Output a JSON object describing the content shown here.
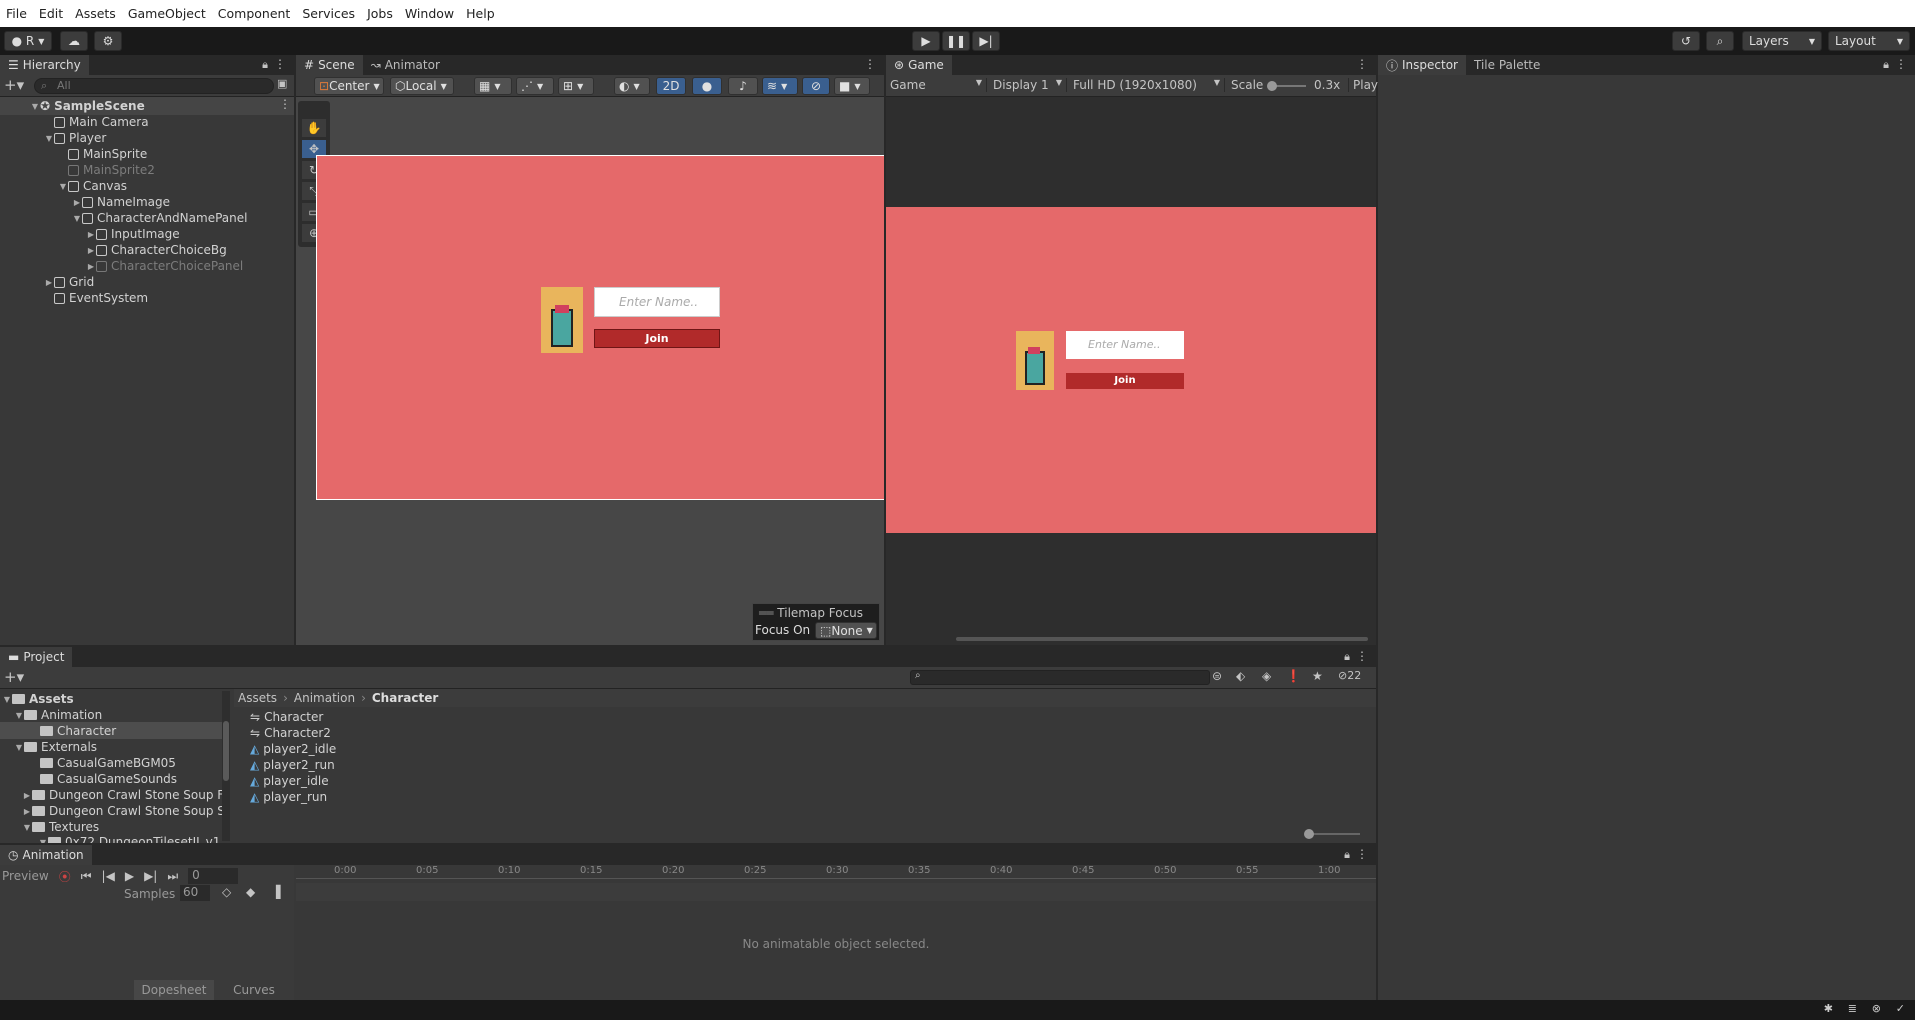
{
  "menu": [
    "File",
    "Edit",
    "Assets",
    "GameObject",
    "Component",
    "Services",
    "Jobs",
    "Window",
    "Help"
  ],
  "toolbar": {
    "account": "R",
    "layers": "Layers",
    "layout": "Layout"
  },
  "hierarchy": {
    "tab": "Hierarchy",
    "search_placeholder": "All",
    "items": [
      {
        "label": "SampleScene",
        "bold": true
      },
      {
        "label": "Main Camera"
      },
      {
        "label": "Player"
      },
      {
        "label": "MainSprite"
      },
      {
        "label": "MainSprite2"
      },
      {
        "label": "Canvas"
      },
      {
        "label": "NameImage"
      },
      {
        "label": "CharacterAndNamePanel"
      },
      {
        "label": "InputImage"
      },
      {
        "label": "CharacterChoiceBg"
      },
      {
        "label": "CharacterChoicePanel"
      },
      {
        "label": "Grid"
      },
      {
        "label": "EventSystem"
      }
    ]
  },
  "scene": {
    "tab_scene": "Scene",
    "tab_animator": "Animator",
    "pivot": "Center",
    "space": "Local",
    "mode_2d": "2D",
    "input_placeholder": "Enter Name..",
    "join": "Join",
    "tilemap_focus": "Tilemap Focus",
    "focus_on": "Focus On",
    "focus_value": "None"
  },
  "game": {
    "tab": "Game",
    "view": "Game",
    "display": "Display 1",
    "resolution": "Full HD (1920x1080)",
    "scale_label": "Scale",
    "scale_value": "0.3x",
    "play": "Play",
    "input_placeholder": "Enter Name..",
    "join": "Join"
  },
  "inspector": {
    "tab": "Inspector",
    "tab2": "Tile Palette"
  },
  "project": {
    "tab": "Project",
    "tree": [
      {
        "label": "Assets",
        "bold": true
      },
      {
        "label": "Animation"
      },
      {
        "label": "Character"
      },
      {
        "label": "Externals"
      },
      {
        "label": "CasualGameBGM05"
      },
      {
        "label": "CasualGameSounds"
      },
      {
        "label": "Dungeon Crawl Stone Soup F"
      },
      {
        "label": "Dungeon Crawl Stone Soup S"
      },
      {
        "label": "Textures"
      },
      {
        "label": "0x72 DungeonTilesetII_v1"
      }
    ],
    "breadcrumb": [
      "Assets",
      "Animation",
      "Character"
    ],
    "hidden_count": "22",
    "files": [
      "Character",
      "Character2",
      "player2_idle",
      "player2_run",
      "player_idle",
      "player_run"
    ]
  },
  "animation": {
    "tab": "Animation",
    "preview": "Preview",
    "frame": "0",
    "samples_label": "Samples",
    "samples": "60",
    "empty": "No animatable object selected.",
    "dopesheet": "Dopesheet",
    "curves": "Curves",
    "ticks": [
      "0:00",
      "0:05",
      "0:10",
      "0:15",
      "0:20",
      "0:25",
      "0:30",
      "0:35",
      "0:40",
      "0:45",
      "0:50",
      "0:55",
      "1:00"
    ]
  },
  "colors": {
    "canvas": "#e5696a",
    "join": "#b12a2a",
    "accent": "#3a5f8f"
  }
}
